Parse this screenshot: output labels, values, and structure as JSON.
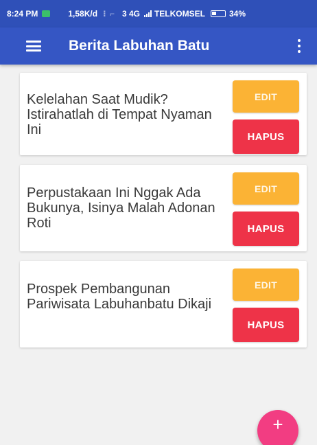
{
  "status_bar": {
    "time": "8:24 PM",
    "speed": "1,58K/d",
    "dim_icons": "⁝ ⌐",
    "network": "3 4G",
    "carrier": "TELKOMSEL",
    "battery_percent": "34%"
  },
  "app_bar": {
    "title": "Berita Labuhan Batu",
    "icons": [
      "menu-icon",
      "more-vert-icon"
    ]
  },
  "news_items": [
    {
      "title": "Kelelahan Saat Mudik? Istirahatlah di Tempat Nyaman Ini",
      "edit_label": "EDIT",
      "delete_label": "HAPUS"
    },
    {
      "title": "Perpustakaan Ini Nggak Ada Bukunya, Isinya Malah Adonan Roti",
      "edit_label": "EDIT",
      "delete_label": "HAPUS"
    },
    {
      "title": "Prospek Pembangunan Pariwisata Labuhanbatu Dikaji",
      "edit_label": "EDIT",
      "delete_label": "HAPUS"
    }
  ],
  "fab": {
    "label": "+",
    "icon": "add-icon"
  },
  "colors": {
    "status_bar": "#2f50b8",
    "app_bar": "#3556c4",
    "edit_button": "#fbb335",
    "delete_button": "#ee3348",
    "fab": "#f23d82",
    "background": "#f1f1f1"
  }
}
